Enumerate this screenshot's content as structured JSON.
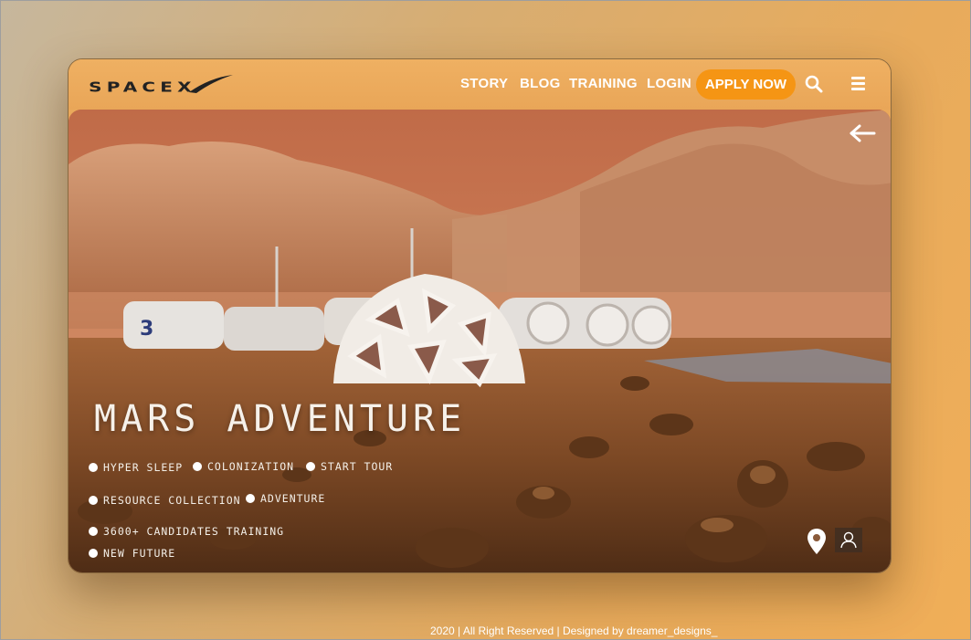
{
  "header": {
    "logo_text": "SPACEX",
    "nav": [
      {
        "label": "STORY"
      },
      {
        "label": "BLOG"
      },
      {
        "label": "TRAINING"
      },
      {
        "label": "LOGIN"
      }
    ],
    "apply_label": "APPLY NOW",
    "icons": {
      "search": "search-icon",
      "menu": "menu-icon"
    }
  },
  "hero": {
    "title": "MARS ADVENTURE",
    "module_number": "3",
    "tags": [
      {
        "label": "HYPER SLEEP"
      },
      {
        "label": "COLONIZATION"
      },
      {
        "label": "START TOUR"
      },
      {
        "label": "RESOURCE COLLECTION"
      },
      {
        "label": "ADVENTURE"
      },
      {
        "label": "3600+ CANDIDATES TRAINING"
      },
      {
        "label": "NEW FUTURE"
      }
    ],
    "icons": {
      "back": "arrow-left-icon",
      "location": "location-pin-icon",
      "user": "user-icon"
    }
  },
  "footer": {
    "text": "2020 | All Right Reserved | Designed by dreamer_designs_"
  },
  "colors": {
    "accent": "#f59514",
    "navbar": "#eaa95b",
    "text": "#ffffff"
  }
}
